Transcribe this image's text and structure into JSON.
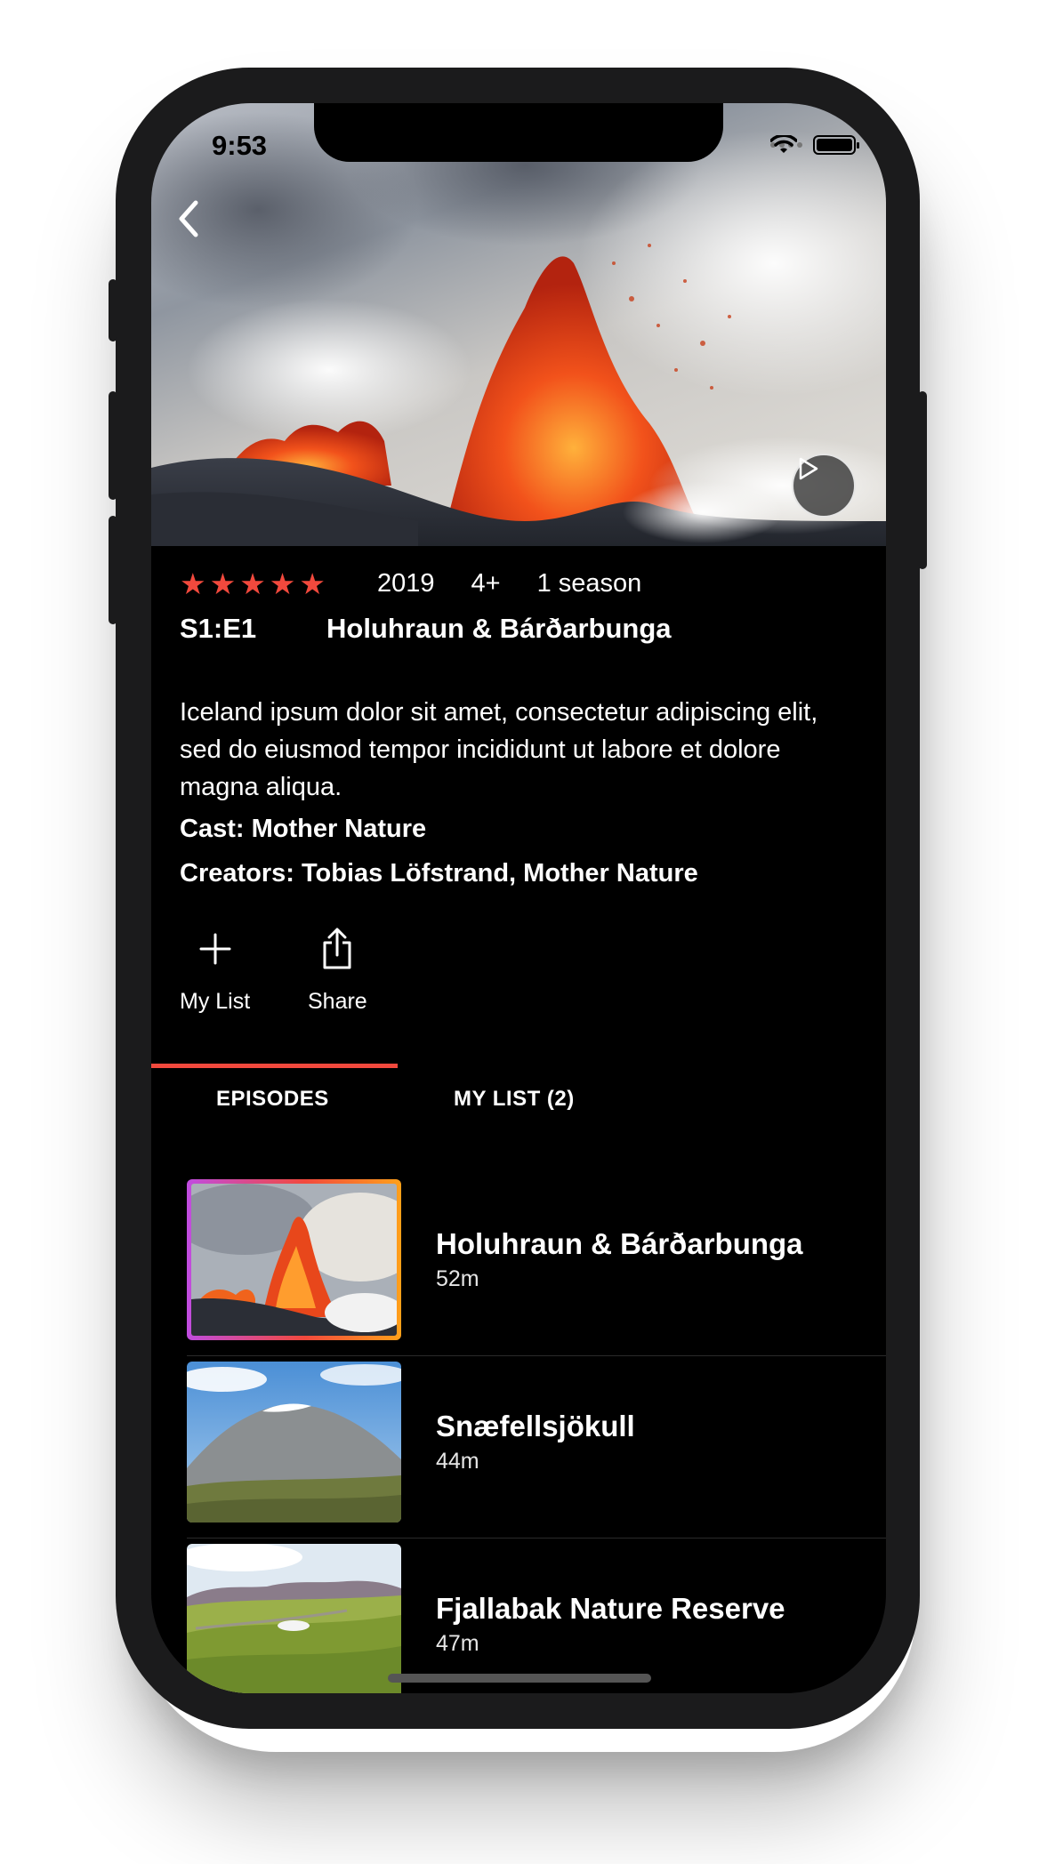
{
  "status_bar": {
    "time": "9:53"
  },
  "hero": {
    "image": "volcanic eruption lava fountain",
    "back_icon": "chevron-left-icon",
    "play_icon": "play-icon"
  },
  "meta": {
    "rating": 5,
    "year": "2019",
    "age_rating": "4+",
    "seasons": "1 season"
  },
  "episode": {
    "code": "S1:E1",
    "title": "Holuhraun & Bárðarbunga"
  },
  "description": "Iceland ipsum dolor sit amet, consectetur adipiscing elit, sed do eiusmod tempor incididunt ut labore et dolore magna aliqua.",
  "cast": "Cast: Mother Nature",
  "creators": "Creators: Tobias Löfstrand, Mother Nature",
  "actions": [
    {
      "label": "My List",
      "icon": "plus-icon"
    },
    {
      "label": "Share",
      "icon": "share-icon"
    }
  ],
  "tabs": [
    {
      "label": "EPISODES",
      "active": true
    },
    {
      "label": "MY LIST (2)",
      "active": false
    }
  ],
  "episodes": [
    {
      "title": "Holuhraun & Bárðarbunga",
      "duration": "52m",
      "selected": true
    },
    {
      "title": "Snæfellsjökull",
      "duration": "44m",
      "selected": false
    },
    {
      "title": "Fjallabak Nature Reserve",
      "duration": "47m",
      "selected": false
    }
  ],
  "colors": {
    "accent": "#f2493d",
    "background": "#000000",
    "text": "#ffffff"
  }
}
